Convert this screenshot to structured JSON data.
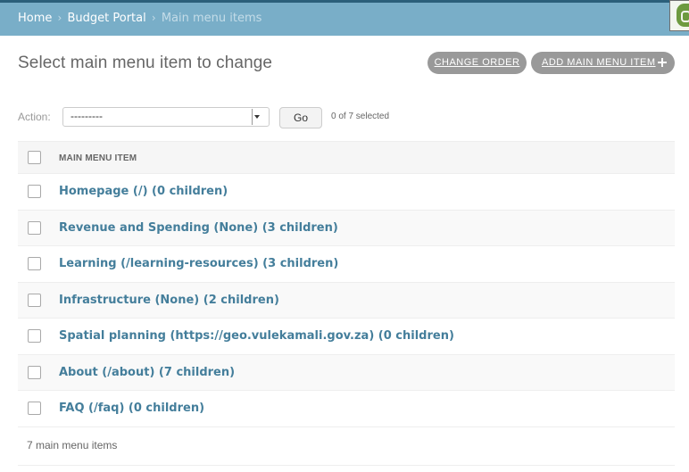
{
  "breadcrumbs": {
    "home": "Home",
    "sep1": "›",
    "app": "Budget Portal",
    "sep2": "›",
    "current": "Main menu items"
  },
  "page": {
    "title": "Select main menu item to change"
  },
  "tools": {
    "change_order": "CHANGE ORDER",
    "add_item": "ADD MAIN MENU ITEM",
    "add_icon": "plus-icon"
  },
  "actions": {
    "label": "Action:",
    "selected_value": "---------",
    "go_label": "Go",
    "counter": "0 of 7 selected"
  },
  "table": {
    "column_header": "MAIN MENU ITEM",
    "rows": [
      {
        "label": "Homepage (/) (0 children)"
      },
      {
        "label": "Revenue and Spending (None) (3 children)"
      },
      {
        "label": "Learning (/learning-resources) (3 children)"
      },
      {
        "label": "Infrastructure (None) (2 children)"
      },
      {
        "label": "Spatial planning (https://geo.vulekamali.gov.za) (0 children)"
      },
      {
        "label": "About (/about) (7 children)"
      },
      {
        "label": "FAQ (/faq) (0 children)"
      }
    ]
  },
  "paginator": {
    "text": "7 main menu items"
  },
  "colors": {
    "header_bar": "#79aec8",
    "link": "#447e9b",
    "tool_button": "#999999"
  }
}
